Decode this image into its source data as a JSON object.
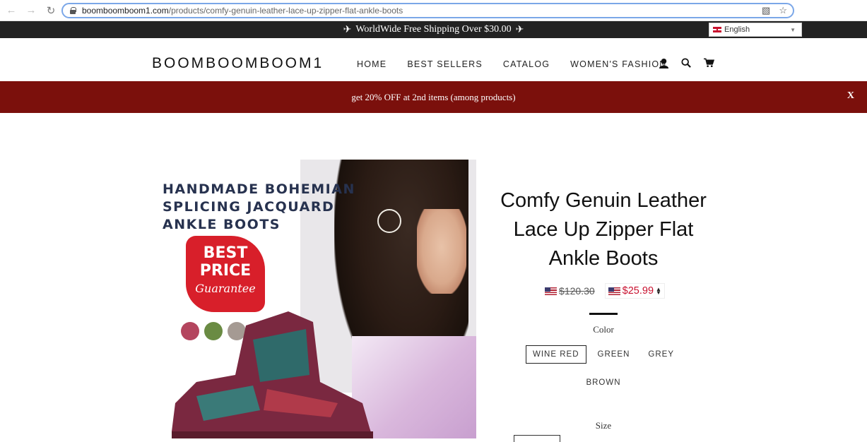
{
  "browser": {
    "url_domain": "boomboomboom1.com",
    "url_path": "/products/comfy-genuin-leather-lace-up-zipper-flat-ankle-boots"
  },
  "announcement": {
    "text": "WorldWide Free Shipping Over $30.00",
    "language": "English"
  },
  "header": {
    "logo": "BOOMBOOMBOOM1",
    "nav": [
      "HOME",
      "BEST SELLERS",
      "CATALOG",
      "WOMEN'S FASHION"
    ]
  },
  "promo": {
    "text": "get 20% OFF at 2nd items (among products)",
    "close": "X"
  },
  "product_image": {
    "title_lines": [
      "HANDMADE BOHEMIAN",
      "SPLICING JACQUARD",
      "ANKLE BOOTS"
    ],
    "badge_line1": "BEST",
    "badge_line2": "PRICE",
    "badge_line3": "Guarantee",
    "swatch_colors": [
      "#b4455e",
      "#6a8b43",
      "#a59a93",
      "#b37535"
    ]
  },
  "product": {
    "title": "Comfy Genuin Leather Lace Up Zipper Flat Ankle Boots",
    "original_price": "$120.30",
    "sale_price": "$25.99",
    "color_label": "Color",
    "colors": [
      "WINE RED",
      "GREEN",
      "GREY",
      "BROWN"
    ],
    "selected_color": "WINE RED",
    "size_label": "Size"
  }
}
